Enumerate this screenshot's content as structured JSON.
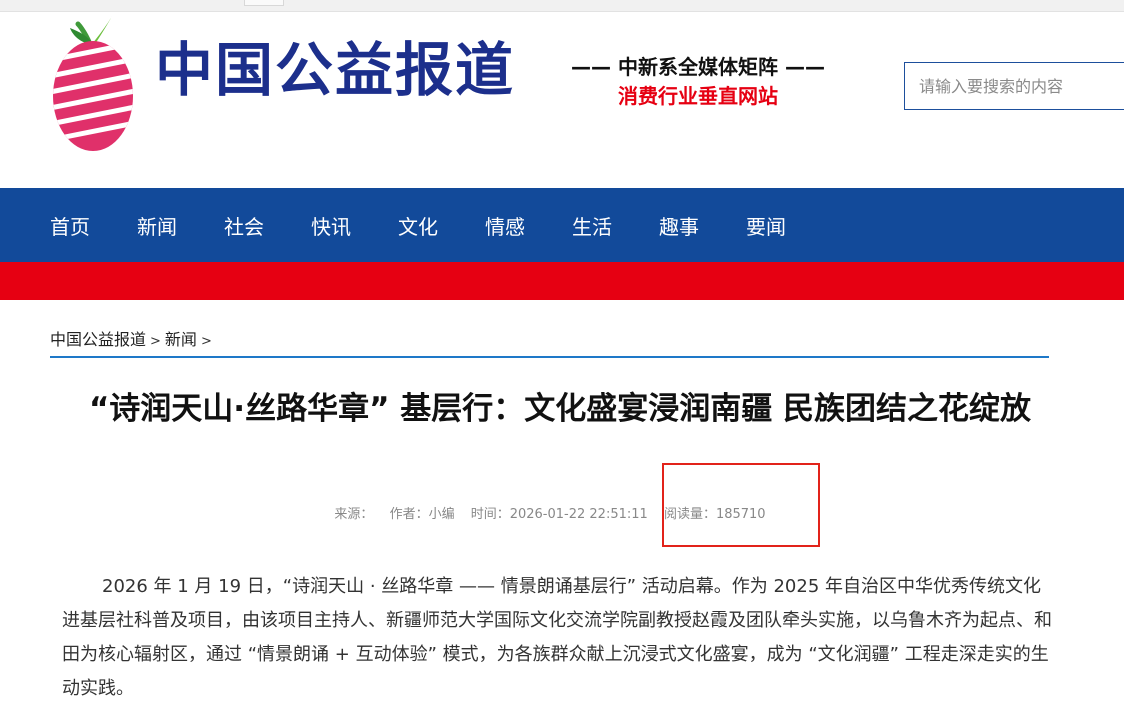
{
  "site": {
    "brand_name": "中国公益报道",
    "slogan_line1": "—— 中新系全媒体矩阵 ——",
    "slogan_line2": "消费行业垂直网站",
    "search_placeholder": "请输入要搜索的内容"
  },
  "nav": {
    "items": [
      "首页",
      "新闻",
      "社会",
      "快讯",
      "文化",
      "情感",
      "生活",
      "趣事",
      "要闻"
    ]
  },
  "breadcrumb": {
    "home": "中国公益报道",
    "sep": ">",
    "section": "新闻"
  },
  "article": {
    "title": "“诗润天山·丝路华章” 基层行：文化盛宴浸润南疆 民族团结之花绽放",
    "meta": {
      "source_label": "来源：",
      "author": "作者：小编",
      "time": "时间：2026-01-22 22:51:11",
      "reads": "阅读量：185710"
    },
    "body": "2026 年 1 月 19 日，“诗润天山 · 丝路华章 —— 情景朗诵基层行” 活动启幕。作为 2025 年自治区中华优秀传统文化进基层社科普及项目，由该项目主持人、新疆师范大学国际文化交流学院副教授赵霞及团队牵头实施，以乌鲁木齐为起点、和田为核心辐射区，通过 “情景朗诵 + 互动体验” 模式，为各族群众献上沉浸式文化盛宴，成为 “文化润疆” 工程走深走实的生动实践。"
  },
  "colors": {
    "nav_blue": "#124a9a",
    "band_red": "#e60012",
    "brand_blue": "#1c2f8c",
    "highlight_box": "#e2231a"
  }
}
